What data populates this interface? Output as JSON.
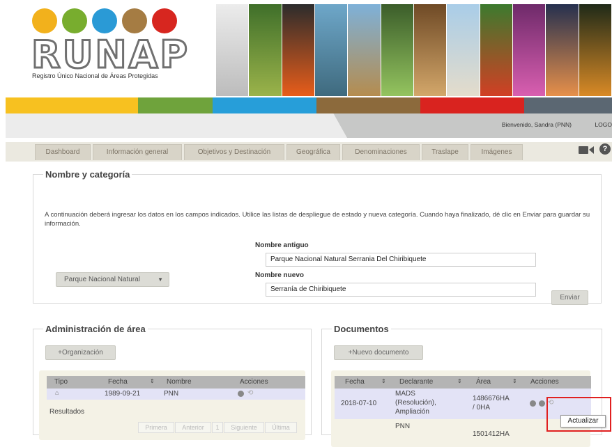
{
  "header": {
    "logo_text": "RUNAP",
    "tagline": "Registro Único Nacional de Áreas Protegidas",
    "welcome": "Bienvenido, Sandra (PNN)",
    "logout": "LOGO",
    "help": "?"
  },
  "colors": {
    "bar": [
      "#f7c120",
      "#f0a81e",
      "#6fa33c",
      "#279ed9",
      "#8c6a3c",
      "#d9231f",
      "#5b6772"
    ]
  },
  "tabs": [
    "Dashboard",
    "Información general",
    "Objetivos y Destinación",
    "Geográfica",
    "Denominaciones",
    "Traslape",
    "Imágenes"
  ],
  "nombre": {
    "legend": "Nombre y categoría",
    "description": "A continuación deberá ingresar los datos en los campos indicados. Utilice las listas de despliegue de estado y nueva categoría. Cuando haya finalizado, dé clic en Enviar para guardar su información.",
    "old_label": "Nombre antiguo",
    "old_value": "Parque Nacional Natural Serrania Del Chiribiquete",
    "new_label": "Nombre nuevo",
    "new_value": "Serranía de Chiribiquete",
    "category": "Parque Nacional Natural",
    "submit": "Enviar"
  },
  "admin": {
    "legend": "Administración de área",
    "add_button": "+Organización",
    "columns": [
      "Tipo",
      "Fecha",
      "Nombre",
      "Acciones"
    ],
    "row": {
      "fecha": "1989-09-21",
      "nombre": "PNN"
    },
    "results": "Resultados",
    "pager": [
      "Primera",
      "Anterior",
      "1",
      "Siguiente",
      "Última"
    ]
  },
  "docs": {
    "legend": "Documentos",
    "add_button": "+Nuevo documento",
    "columns": [
      "Fecha",
      "Declarante",
      "Área",
      "Acciones"
    ],
    "row1": {
      "fecha": "2018-07-10",
      "declarante": [
        "MADS",
        "(Resolución),",
        "Ampliación"
      ],
      "area": [
        "1486676HA",
        "/ 0HA"
      ]
    },
    "row2": {
      "declarante": "PNN",
      "area": "1501412HA"
    }
  },
  "tooltip": "Actualizar"
}
